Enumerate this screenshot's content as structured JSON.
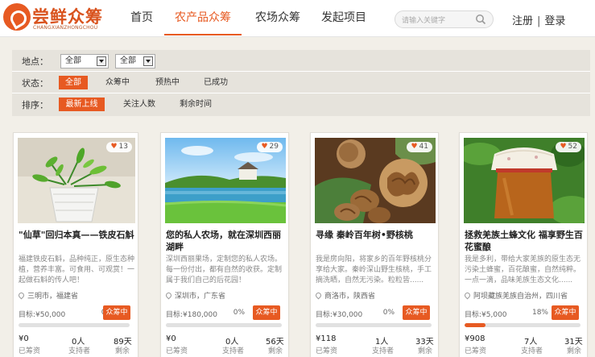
{
  "brand": {
    "name": "尝鲜众筹",
    "sub": "CHANGXIANZHONGCHOU"
  },
  "nav": [
    {
      "label": "首页",
      "active": false
    },
    {
      "label": "农产品众筹",
      "active": true
    },
    {
      "label": "农场众筹",
      "active": false
    },
    {
      "label": "发起项目",
      "active": false
    }
  ],
  "search": {
    "placeholder": "请输入关键字"
  },
  "auth": {
    "register": "注册",
    "sep": "|",
    "login": "登录"
  },
  "filters": {
    "location": {
      "label": "地点：",
      "province": "全部",
      "city": "全部"
    },
    "status": {
      "label": "状态：",
      "options": [
        "全部",
        "众筹中",
        "预热中",
        "已成功"
      ],
      "selected": "全部"
    },
    "sort": {
      "label": "排序：",
      "options": [
        "最新上线",
        "关注人数",
        "剩余时间"
      ],
      "selected": "最新上线"
    }
  },
  "labels": {
    "goal_prefix": "目标:",
    "raised": "已筹资",
    "supporters": "支持者",
    "remaining": "剩余"
  },
  "projects": [
    {
      "likes": "13",
      "title": "\"仙草\"回归本真——铁皮石斛",
      "desc": "福建铁皮石斛，品种纯正，原生态种植，营养丰富。可食用、可观赏！一起做石斛的传人吧！",
      "location": "三明市，福建省",
      "goal": "¥50,000",
      "percent": "0%",
      "progress": 0,
      "status": "众筹中",
      "raised": "¥0",
      "supporters": "0人",
      "days": "89天"
    },
    {
      "likes": "29",
      "title": "您的私人农场，就在深圳西丽湖畔",
      "desc": "深圳西丽果场，定制您的私人农场。每一份付出，都有自然的收获。定制属于我们自己的后花园！",
      "location": "深圳市，广东省",
      "goal": "¥180,000",
      "percent": "0%",
      "progress": 0,
      "status": "众筹中",
      "raised": "¥0",
      "supporters": "0人",
      "days": "56天"
    },
    {
      "likes": "41",
      "title": "寻缘 秦岭百年树•野核桃",
      "desc": "我是房向阳，将家乡的百年野核桃分享给大家。秦岭深山野生核桃，手工摘洗晒，自然无污染。粒粒皆......",
      "location": "商洛市，陕西省",
      "goal": "¥30,000",
      "percent": "0%",
      "progress": 0,
      "status": "众筹中",
      "raised": "¥118",
      "supporters": "1人",
      "days": "33天"
    },
    {
      "likes": "52",
      "title": "拯救羌族土蜂文化 福享野生百花蜜酿",
      "desc": "我是多利，带给大家羌族的原生态无污染土蜂蜜，百花酿蜜，自然纯粹。一点一滴，品味羌族生态文化......",
      "location": "阿坝藏族羌族自治州，四川省",
      "goal": "¥5,000",
      "percent": "18%",
      "progress": 18,
      "status": "众筹中",
      "raised": "¥908",
      "supporters": "7人",
      "days": "31天"
    }
  ],
  "colors": {
    "accent": "#e75a22",
    "background": "#f2efe8",
    "filter_bg": "#e6e3dc"
  }
}
